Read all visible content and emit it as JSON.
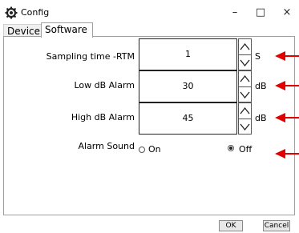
{
  "window": {
    "title": "Config",
    "minimize_glyph": "–",
    "maximize_glyph": "□",
    "close_glyph": "×"
  },
  "tabs": [
    {
      "label": "Device",
      "active": false
    },
    {
      "label": "Software",
      "active": true
    }
  ],
  "settings": [
    {
      "label": "Sampling time -RTM",
      "value": "1",
      "unit": "S"
    },
    {
      "label": "Low dB Alarm",
      "value": "30",
      "unit": "dB"
    },
    {
      "label": "High dB Alarm",
      "value": "45",
      "unit": "dB"
    }
  ],
  "alarm_sound": {
    "label": "Alarm Sound",
    "options": [
      {
        "label": "On",
        "selected": false
      },
      {
        "label": "Off",
        "selected": true
      }
    ]
  },
  "buttons": {
    "ok": "OK",
    "cancel": "Cancel"
  },
  "annotation_color": "#e00000"
}
